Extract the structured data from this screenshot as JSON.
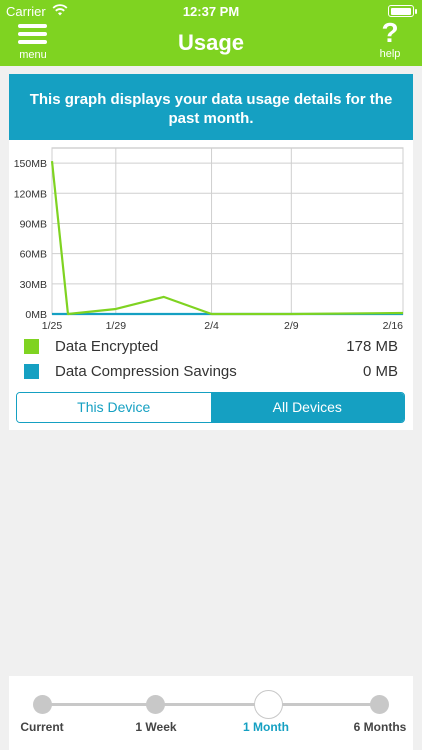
{
  "status_bar": {
    "carrier": "Carrier",
    "time": "12:37 PM",
    "battery_level": 1.0
  },
  "header": {
    "title": "Usage",
    "menu_label": "menu",
    "help_glyph": "?",
    "help_label": "help"
  },
  "banner": {
    "text": "This graph displays your data usage details for the past month."
  },
  "chart_data": {
    "type": "line",
    "x": [
      "1/25",
      "1/26",
      "1/29",
      "2/1",
      "2/4",
      "2/9",
      "2/16"
    ],
    "x_ticks": [
      "1/25",
      "1/29",
      "2/4",
      "2/9",
      "2/16"
    ],
    "y_ticks": [
      "0MB",
      "30MB",
      "60MB",
      "90MB",
      "120MB",
      "150MB"
    ],
    "ylim": [
      0,
      165
    ],
    "grid": true,
    "series": [
      {
        "name": "Data Encrypted",
        "color": "#7fd321",
        "values": [
          152,
          0,
          5,
          17,
          0,
          0,
          1
        ]
      },
      {
        "name": "Data Compression Savings",
        "color": "#15a0c2",
        "values": [
          0,
          0,
          0,
          0,
          0,
          0,
          0
        ]
      }
    ]
  },
  "legend": [
    {
      "label": "Data Encrypted",
      "value": "178 MB",
      "color": "#7fd321"
    },
    {
      "label": "Data Compression Savings",
      "value": "0 MB",
      "color": "#15a0c2"
    }
  ],
  "device_toggle": {
    "options": [
      "This Device",
      "All Devices"
    ],
    "selected": "All Devices"
  },
  "time_range": {
    "options": [
      "Current",
      "1 Week",
      "1 Month",
      "6 Months"
    ],
    "selected": "1 Month"
  },
  "colors": {
    "brand_green": "#7fd321",
    "accent_blue": "#15a0c2"
  }
}
